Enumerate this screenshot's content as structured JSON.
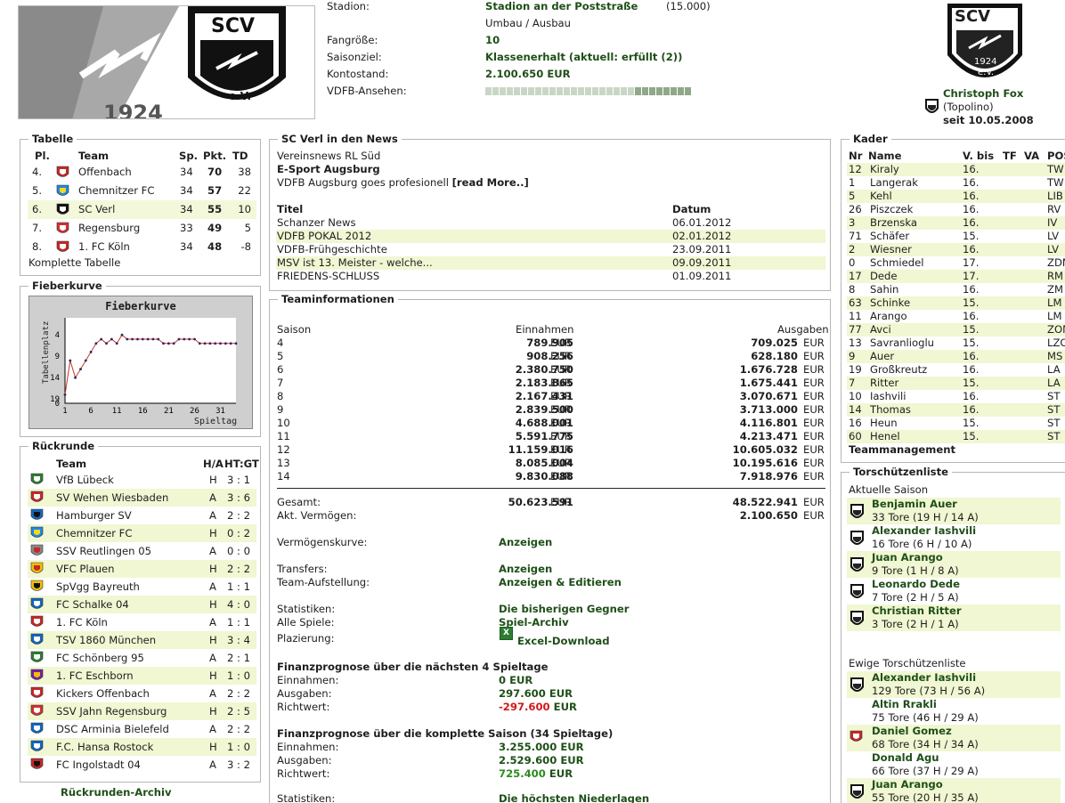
{
  "header": {
    "banner_year": "1924",
    "logo_top": "SCV",
    "logo_year": "1924",
    "logo_ev": "e.V.",
    "info": [
      {
        "label": "Stadion:",
        "value": "Stadion an der Poststraße",
        "extra": "(15.000)"
      },
      {
        "label": "",
        "value": "",
        "extra": "Umbau / Ausbau"
      },
      {
        "label": "Fangröße:",
        "value": "10",
        "extra": ""
      },
      {
        "label": "Saisonziel:",
        "value": "Klassenerhalt (aktuell: erfüllt (2))",
        "extra": ""
      },
      {
        "label": "Kontostand:",
        "value": "2.100.650 EUR",
        "extra": ""
      },
      {
        "label": "VDFB-Ansehen:",
        "value": "",
        "extra": ""
      }
    ],
    "ansehen": 0.72,
    "manager_name": "Christoph Fox",
    "manager_nick": "(Topolino)",
    "manager_since": "seit 10.05.2008"
  },
  "tabelle": {
    "title": "Tabelle",
    "cols": [
      "Pl.",
      "Team",
      "Sp.",
      "Pkt.",
      "TD"
    ],
    "rows": [
      {
        "pl": "4.",
        "team": "Offenbach",
        "sp": "34",
        "pkt": "70",
        "td": "38",
        "icon": "offenbach-crest-icon"
      },
      {
        "pl": "5.",
        "team": "Chemnitzer FC",
        "sp": "34",
        "pkt": "57",
        "td": "22",
        "icon": "chemnitz-crest-icon"
      },
      {
        "pl": "6.",
        "team": "SC Verl",
        "sp": "34",
        "pkt": "55",
        "td": "10",
        "icon": "scv-crest-icon"
      },
      {
        "pl": "7.",
        "team": "Regensburg",
        "sp": "33",
        "pkt": "49",
        "td": "5",
        "icon": "regensburg-crest-icon"
      },
      {
        "pl": "8.",
        "team": "1. FC Köln",
        "sp": "34",
        "pkt": "48",
        "td": "-8",
        "icon": "koeln-crest-icon"
      }
    ],
    "link": "Komplette Tabelle"
  },
  "fieberkurve": {
    "title": "Fieberkurve",
    "chart_title": "Fieberkurve",
    "ylabel": "Tabellenplatz",
    "xlabel": "Spieltag",
    "chart_data": {
      "type": "line",
      "title": "Fieberkurve",
      "xlabel": "Spieltag",
      "ylabel": "Tabellenplatz",
      "xticks": [
        "1",
        "6",
        "11",
        "16",
        "21",
        "26",
        "31"
      ],
      "yticks": [
        "4",
        "9",
        "14",
        "19",
        "0"
      ],
      "x": [
        1,
        2,
        3,
        4,
        5,
        6,
        7,
        8,
        9,
        10,
        11,
        12,
        13,
        14,
        15,
        16,
        17,
        18,
        19,
        20,
        21,
        22,
        23,
        24,
        25,
        26,
        27,
        28,
        29,
        30,
        31,
        32,
        33,
        34
      ],
      "values": [
        18,
        10,
        14,
        12,
        10,
        8,
        6,
        5,
        6,
        5,
        6,
        4,
        5,
        5,
        5,
        5,
        5,
        5,
        5,
        6,
        6,
        6,
        5,
        5,
        5,
        5,
        6,
        6,
        6,
        6,
        6,
        6,
        6,
        6
      ]
    }
  },
  "rueckrunde": {
    "title": "Rückrunde",
    "cols": [
      "Team",
      "H/A",
      "HT:GT"
    ],
    "rows": [
      {
        "team": "VfB Lübeck",
        "ha": "H",
        "score": "3 : 1",
        "bold": false,
        "icon": "vfb-luebeck-crest-icon"
      },
      {
        "team": "SV Wehen Wiesbaden",
        "ha": "A",
        "score": "3 : 6",
        "bold": true,
        "icon": "wehen-crest-icon"
      },
      {
        "team": "Hamburger SV",
        "ha": "A",
        "score": "2 : 2",
        "bold": false,
        "icon": "hsv-crest-icon"
      },
      {
        "team": "Chemnitzer FC",
        "ha": "H",
        "score": "0 : 2",
        "bold": true,
        "icon": "chemnitz-crest-icon"
      },
      {
        "team": "SSV Reutlingen 05",
        "ha": "A",
        "score": "0 : 0",
        "bold": false,
        "icon": "reutlingen-crest-icon"
      },
      {
        "team": "VFC Plauen",
        "ha": "H",
        "score": "2 : 2",
        "bold": true,
        "icon": "plauen-crest-icon"
      },
      {
        "team": "SpVgg Bayreuth",
        "ha": "A",
        "score": "1 : 1",
        "bold": false,
        "icon": "bayreuth-crest-icon"
      },
      {
        "team": "FC Schalke 04",
        "ha": "H",
        "score": "4 : 0",
        "bold": true,
        "icon": "schalke-crest-icon"
      },
      {
        "team": "1. FC Köln",
        "ha": "A",
        "score": "1 : 1",
        "bold": false,
        "icon": "koeln-crest-icon"
      },
      {
        "team": "TSV 1860 München",
        "ha": "H",
        "score": "3 : 4",
        "bold": true,
        "icon": "1860-crest-icon"
      },
      {
        "team": "FC Schönberg 95",
        "ha": "A",
        "score": "2 : 1",
        "bold": false,
        "icon": "schoenberg-crest-icon"
      },
      {
        "team": "1. FC Eschborn",
        "ha": "H",
        "score": "1 : 0",
        "bold": true,
        "icon": "eschborn-crest-icon"
      },
      {
        "team": "Kickers Offenbach",
        "ha": "A",
        "score": "2 : 2",
        "bold": false,
        "icon": "offenbach-crest-icon"
      },
      {
        "team": "SSV Jahn Regensburg",
        "ha": "H",
        "score": "2 : 5",
        "bold": true,
        "icon": "regensburg-crest-icon"
      },
      {
        "team": "DSC Arminia Bielefeld",
        "ha": "A",
        "score": "2 : 2",
        "bold": false,
        "icon": "bielefeld-crest-icon"
      },
      {
        "team": "F.C. Hansa Rostock",
        "ha": "H",
        "score": "1 : 0",
        "bold": true,
        "icon": "rostock-crest-icon"
      },
      {
        "team": "FC Ingolstadt 04",
        "ha": "A",
        "score": "3 : 2",
        "bold": false,
        "icon": "ingolstadt-crest-icon"
      }
    ],
    "link": "Rückrunden-Archiv"
  },
  "news": {
    "title": "SC Verl in den News",
    "kicker": "Vereinsnews RL Süd",
    "headline": "E-Sport Augsburg",
    "teaser": "VDFB Augsburg goes profesionell",
    "read_more": "[read More..]",
    "col_title": "Titel",
    "col_date": "Datum",
    "items": [
      {
        "title": "Schanzer News",
        "date": "06.01.2012"
      },
      {
        "title": "VDFB POKAL 2012",
        "date": "02.01.2012"
      },
      {
        "title": "VDFB-Frühgeschichte",
        "date": "23.09.2011"
      },
      {
        "title": "MSV ist 13. Meister - welche...",
        "date": "09.09.2011"
      },
      {
        "title": "FRIEDENS-SCHLUSS",
        "date": "01.09.2011"
      }
    ]
  },
  "team": {
    "title": "Teaminformationen",
    "col_season": "Saison",
    "col_income": "Einnahmen",
    "col_expense": "Ausgaben",
    "seasons": [
      {
        "s": "4",
        "in": "789.905",
        "out": "709.025"
      },
      {
        "s": "5",
        "in": "908.256",
        "out": "628.180"
      },
      {
        "s": "6",
        "in": "2.380.750",
        "out": "1.676.728"
      },
      {
        "s": "7",
        "in": "2.183.865",
        "out": "1.675.441"
      },
      {
        "s": "8",
        "in": "2.167.431",
        "out": "3.070.671"
      },
      {
        "s": "9",
        "in": "2.839.500",
        "out": "3.713.000"
      },
      {
        "s": "10",
        "in": "4.688.001",
        "out": "4.116.801"
      },
      {
        "s": "11",
        "in": "5.591.775",
        "out": "4.213.471"
      },
      {
        "s": "12",
        "in": "11.159.016",
        "out": "10.605.032"
      },
      {
        "s": "13",
        "in": "8.085.004",
        "out": "10.195.616"
      },
      {
        "s": "14",
        "in": "9.830.088",
        "out": "7.918.976"
      }
    ],
    "eur": "EUR",
    "total_label": "Gesamt:",
    "total_in": "50.623.591",
    "total_out": "48.522.941",
    "assets_label": "Akt. Vermögen:",
    "assets": "2.100.650",
    "vk_label": "Vermögenskurve:",
    "vk_link": "Anzeigen",
    "transfers_label": "Transfers:",
    "transfers_link": "Anzeigen",
    "aufst_label": "Team-Aufstellung:",
    "aufst_link": "Anzeigen & Editieren",
    "stat_label": "Statistiken:",
    "stat_link": "Die bisherigen Gegner",
    "spiele_label": "Alle Spiele:",
    "spiele_link": "Spiel-Archiv",
    "platz_label": "Plazierung:",
    "platz_link": "Excel-Download",
    "fp4_title": "Finanzprognose über die nächsten 4 Spieltage",
    "fp4_in_label": "Einnahmen:",
    "fp4_in": "0 EUR",
    "fp4_out_label": "Ausgaben:",
    "fp4_out": "297.600 EUR",
    "fp4_rw_label": "Richtwert:",
    "fp4_rw": "-297.600",
    "fp4_rw_eur": "EUR",
    "fps_title": "Finanzprognose über die komplette Saison (34 Spieltage)",
    "fps_in_label": "Einnahmen:",
    "fps_in": "3.255.000 EUR",
    "fps_out_label": "Ausgaben:",
    "fps_out": "2.529.600 EUR",
    "fps_rw_label": "Richtwert:",
    "fps_rw": "725.400",
    "fps_rw_eur": "EUR",
    "stat2_label": "Statistiken:",
    "stat2_link": "Die höchsten Niederlagen"
  },
  "kader": {
    "title": "Kader",
    "cols": [
      "Nr",
      "Name",
      "V. bis",
      "TF",
      "VA",
      "POS"
    ],
    "players": [
      {
        "nr": "12",
        "name": "Kiraly",
        "vbis": "16.",
        "pos": "TW"
      },
      {
        "nr": "1",
        "name": "Langerak",
        "vbis": "16.",
        "pos": "TW"
      },
      {
        "nr": "5",
        "name": "Kehl",
        "vbis": "16.",
        "pos": "LIB"
      },
      {
        "nr": "26",
        "name": "Piszczek",
        "vbis": "16.",
        "pos": "RV"
      },
      {
        "nr": "3",
        "name": "Brzenska",
        "vbis": "16.",
        "pos": "IV"
      },
      {
        "nr": "71",
        "name": "Schäfer",
        "vbis": "15.",
        "pos": "LV"
      },
      {
        "nr": "2",
        "name": "Wiesner",
        "vbis": "16.",
        "pos": "LV"
      },
      {
        "nr": "0",
        "name": "Schmiedel",
        "vbis": "17.",
        "pos": "ZDM"
      },
      {
        "nr": "17",
        "name": "Dede",
        "vbis": "17.",
        "pos": "RM"
      },
      {
        "nr": "8",
        "name": "Sahin",
        "vbis": "16.",
        "pos": "ZM"
      },
      {
        "nr": "63",
        "name": "Schinke",
        "vbis": "15.",
        "pos": "LM"
      },
      {
        "nr": "11",
        "name": "Arango",
        "vbis": "16.",
        "pos": "LM"
      },
      {
        "nr": "77",
        "name": "Avci",
        "vbis": "15.",
        "pos": "ZOM"
      },
      {
        "nr": "13",
        "name": "Savranlioglu",
        "vbis": "15.",
        "pos": "LZOM"
      },
      {
        "nr": "9",
        "name": "Auer",
        "vbis": "16.",
        "pos": "MS"
      },
      {
        "nr": "19",
        "name": "Großkreutz",
        "vbis": "16.",
        "pos": "LA"
      },
      {
        "nr": "7",
        "name": "Ritter",
        "vbis": "15.",
        "pos": "LA"
      },
      {
        "nr": "10",
        "name": "Iashvili",
        "vbis": "16.",
        "pos": "ST"
      },
      {
        "nr": "14",
        "name": "Thomas",
        "vbis": "16.",
        "pos": "ST"
      },
      {
        "nr": "16",
        "name": "Heun",
        "vbis": "15.",
        "pos": "ST"
      },
      {
        "nr": "60",
        "name": "Henel",
        "vbis": "15.",
        "pos": "ST"
      }
    ],
    "link": "Teammanagement"
  },
  "torschuetzen": {
    "title": "Torschützenliste",
    "current_label": "Aktuelle Saison",
    "current": [
      {
        "name": "Benjamin Auer",
        "stats": "33 Tore (19 H / 14 A)",
        "icon": "scv-crest-icon"
      },
      {
        "name": "Alexander Iashvili",
        "stats": "16 Tore (6 H / 10 A)",
        "icon": "scv-crest-icon"
      },
      {
        "name": "Juan Arango",
        "stats": "9 Tore (1 H / 8 A)",
        "icon": "scv-crest-icon"
      },
      {
        "name": "Leonardo Dede",
        "stats": "7 Tore (2 H / 5 A)",
        "icon": "scv-crest-icon"
      },
      {
        "name": "Christian Ritter",
        "stats": "3 Tore (2 H / 1 A)",
        "icon": "scv-crest-icon"
      }
    ],
    "all_label": "Ewige Torschützenliste",
    "all": [
      {
        "name": "Alexander Iashvili",
        "stats": "129 Tore (73 H / 56 A)",
        "icon": "scv-crest-icon"
      },
      {
        "name": "Altin Rrakli",
        "stats": "75 Tore (46 H / 29 A)",
        "icon": ""
      },
      {
        "name": "Daniel Gomez",
        "stats": "68 Tore (34 H / 34 A)",
        "icon": "wehen-crest-icon"
      },
      {
        "name": "Donald Agu",
        "stats": "66 Tore (37 H / 29 A)",
        "icon": ""
      },
      {
        "name": "Juan Arango",
        "stats": "55 Tore (20 H / 35 A)",
        "icon": "scv-crest-icon"
      }
    ]
  }
}
